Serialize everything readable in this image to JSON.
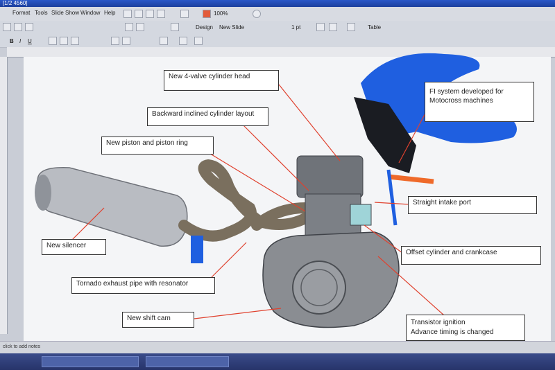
{
  "window": {
    "title": "[1/2 4560]"
  },
  "menu": {
    "items": [
      "Format",
      "Tools",
      "Slide Show",
      "Window",
      "Help"
    ]
  },
  "toolbar": {
    "zoom": "100%",
    "design_label": "Design",
    "new_slide_label": "New Slide",
    "table_label": "Table",
    "line_weight": "1 pt"
  },
  "statusbar": {
    "hint": "click to add notes"
  },
  "slide": {
    "callouts": {
      "cylinder_head": "New 4-valve cylinder head",
      "backward_cylinder": "Backward inclined cylinder layout",
      "piston": "New piston and piston ring",
      "fi_system": "FI system developed for Motocross machines",
      "intake": "Straight intake port",
      "silencer": "New silencer",
      "offset": "Offset cylinder and crankcase",
      "exhaust": "Tornado exhaust pipe with resonator",
      "shift_cam": "New shift cam",
      "ignition_1": "Transistor ignition",
      "ignition_2": "Advance timing is changed"
    }
  },
  "colors": {
    "callout_line": "#e0412e",
    "frame_blue": "#1f5fe0",
    "engine_grey": "#8a8d92"
  }
}
